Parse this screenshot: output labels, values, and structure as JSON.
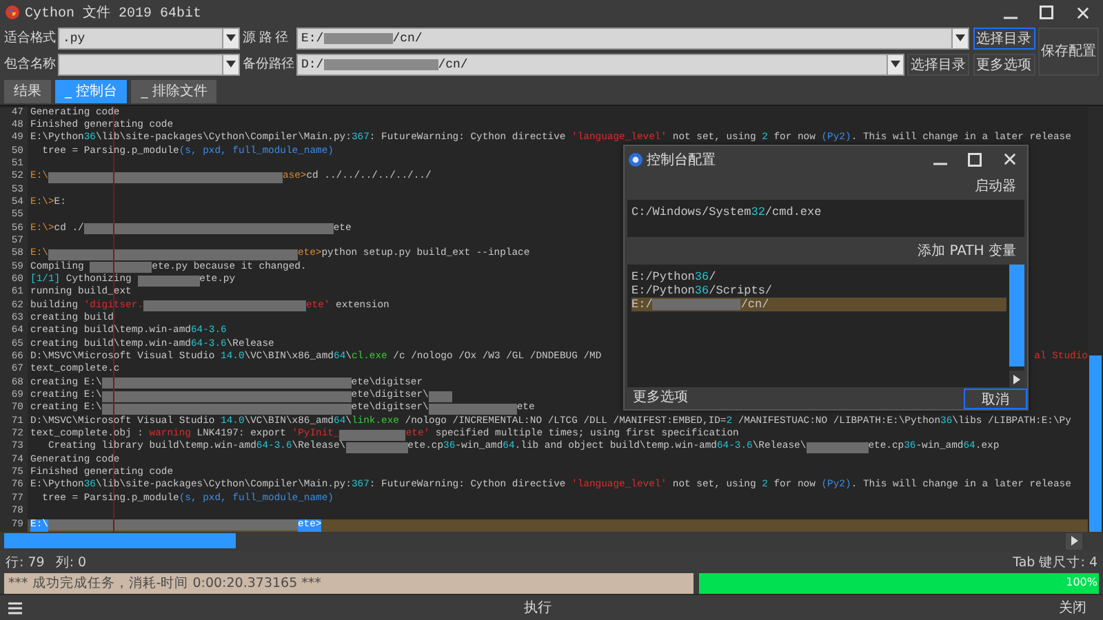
{
  "window": {
    "title": "Cython 文件 2019 64bit"
  },
  "format": {
    "label": "适合格式",
    "value": ".py"
  },
  "source": {
    "label": "源 路 径",
    "value": [
      {
        "kind": "plain",
        "text": "E:/"
      },
      {
        "kind": "redacted"
      },
      {
        "kind": "plain",
        "text": "/cn/"
      }
    ],
    "button": {
      "label": "选择目录",
      "focused": true
    }
  },
  "name_filter": {
    "label": "包含名称"
  },
  "backup": {
    "label": "备份路径",
    "value": [
      {
        "kind": "plain",
        "text": "D:/"
      },
      {
        "kind": "redacted"
      },
      {
        "kind": "plain",
        "text": "/cn/"
      }
    ],
    "button": {
      "label": "选择目录",
      "focused": false
    }
  },
  "more_button": {
    "label": "更多选项",
    "focused": false
  },
  "save_button": {
    "label": "保存配置",
    "focused": false
  },
  "tabs": [
    {
      "label": "结果",
      "selected": false
    },
    {
      "label": "_ 控制台",
      "selected": true
    },
    {
      "label": "_ 排除文件",
      "selected": false
    }
  ],
  "console": {
    "lines": [
      {
        "number": "47",
        "current": false,
        "segs": [
          {
            "kind": "plain",
            "text": "Generating code"
          }
        ]
      },
      {
        "number": "48",
        "current": false,
        "segs": [
          {
            "kind": "plain",
            "text": "Finished generating code"
          }
        ]
      },
      {
        "number": "49",
        "current": false,
        "segs": [
          {
            "kind": "plain",
            "text": "E:\\Python"
          },
          {
            "kind": "num",
            "text": "36"
          },
          {
            "kind": "plain",
            "text": "\\lib\\site-packages\\Cython\\Compiler\\Main.py:"
          },
          {
            "kind": "num",
            "text": "367"
          },
          {
            "kind": "plain",
            "text": ": FutureWarning: Cython directive "
          },
          {
            "kind": "str",
            "text": "'language_level'"
          },
          {
            "kind": "plain",
            "text": " not set, using "
          },
          {
            "kind": "num",
            "text": "2"
          },
          {
            "kind": "plain",
            "text": " for now "
          },
          {
            "kind": "blue",
            "text": "(Py2)"
          },
          {
            "kind": "plain",
            "text": ". This will change in a later release"
          }
        ]
      },
      {
        "number": "50",
        "current": false,
        "segs": [
          {
            "kind": "plain",
            "text": "  tree = Parsing.p_module"
          },
          {
            "kind": "blue",
            "text": "(s, pxd, full_module_name)"
          }
        ]
      },
      {
        "number": "51",
        "current": false
      },
      {
        "number": "52",
        "current": false,
        "segs": [
          {
            "kind": "prompt",
            "text": "E:\\"
          },
          {
            "kind": "redacted"
          },
          {
            "kind": "prompt",
            "text": "ase>"
          },
          {
            "kind": "plain",
            "text": "cd ../../../../../../"
          }
        ]
      },
      {
        "number": "53",
        "current": false
      },
      {
        "number": "54",
        "current": false,
        "segs": [
          {
            "kind": "prompt",
            "text": "E:\\>"
          },
          {
            "kind": "plain",
            "text": "E:"
          }
        ]
      },
      {
        "number": "55",
        "current": false
      },
      {
        "number": "56",
        "current": false,
        "segs": [
          {
            "kind": "prompt",
            "text": "E:\\>"
          },
          {
            "kind": "plain",
            "text": "cd ./"
          },
          {
            "kind": "redacted"
          },
          {
            "kind": "plain",
            "text": "ete"
          }
        ]
      },
      {
        "number": "57",
        "current": false
      },
      {
        "number": "58",
        "current": false,
        "segs": [
          {
            "kind": "prompt",
            "text": "E:\\"
          },
          {
            "kind": "redacted"
          },
          {
            "kind": "prompt",
            "text": "ete>"
          },
          {
            "kind": "plain",
            "text": "python setup.py build_ext --inplace"
          }
        ]
      },
      {
        "number": "59",
        "current": false,
        "segs": [
          {
            "kind": "plain",
            "text": "Compiling "
          },
          {
            "kind": "redacted"
          },
          {
            "kind": "plain",
            "text": "ete.py because it changed."
          }
        ]
      },
      {
        "number": "60",
        "current": false,
        "segs": [
          {
            "kind": "num",
            "text": "[1/1]"
          },
          {
            "kind": "plain",
            "text": " Cythonizing "
          },
          {
            "kind": "redacted"
          },
          {
            "kind": "plain",
            "text": "ete.py"
          }
        ]
      },
      {
        "number": "61",
        "current": false,
        "segs": [
          {
            "kind": "plain",
            "text": "running build_ext"
          }
        ]
      },
      {
        "number": "62",
        "current": false,
        "segs": [
          {
            "kind": "plain",
            "text": "building "
          },
          {
            "kind": "str",
            "text": "'digitser."
          },
          {
            "kind": "redacted"
          },
          {
            "kind": "str",
            "text": "ete'"
          },
          {
            "kind": "plain",
            "text": " extension"
          }
        ]
      },
      {
        "number": "63",
        "current": false,
        "segs": [
          {
            "kind": "plain",
            "text": "creating build"
          }
        ]
      },
      {
        "number": "64",
        "current": false,
        "segs": [
          {
            "kind": "plain",
            "text": "creating build\\temp.win-amd"
          },
          {
            "kind": "num",
            "text": "64-3.6"
          }
        ]
      },
      {
        "number": "65",
        "current": false,
        "segs": [
          {
            "kind": "plain",
            "text": "creating build\\temp.win-amd"
          },
          {
            "kind": "num",
            "text": "64-3.6"
          },
          {
            "kind": "plain",
            "text": "\\Release"
          }
        ]
      },
      {
        "number": "66",
        "current": false,
        "segs": [
          {
            "kind": "plain",
            "text": "D:\\MSVC\\Microsoft Visual Studio "
          },
          {
            "kind": "num",
            "text": "14.0"
          },
          {
            "kind": "plain",
            "text": "\\VC\\BIN\\x86_amd"
          },
          {
            "kind": "num",
            "text": "64"
          },
          {
            "kind": "plain",
            "text": "\\"
          },
          {
            "kind": "call",
            "text": "cl.exe"
          },
          {
            "kind": "plain",
            "text": " /c /nologo /Ox /W3 /GL /DNDEBUG /MD"
          },
          {
            "kind": "gap"
          },
          {
            "kind": "str",
            "text": "al Studio"
          }
        ]
      },
      {
        "number": "67",
        "current": false,
        "segs": [
          {
            "kind": "plain",
            "text": "text_complete.c"
          }
        ]
      },
      {
        "number": "68",
        "current": false,
        "segs": [
          {
            "kind": "plain",
            "text": "creating E:\\"
          },
          {
            "kind": "redacted"
          },
          {
            "kind": "plain",
            "text": "ete\\digitser"
          }
        ]
      },
      {
        "number": "69",
        "current": false,
        "segs": [
          {
            "kind": "plain",
            "text": "creating E:\\"
          },
          {
            "kind": "redacted"
          },
          {
            "kind": "plain",
            "text": "ete\\digitser\\"
          },
          {
            "kind": "redacted"
          }
        ]
      },
      {
        "number": "70",
        "current": false,
        "segs": [
          {
            "kind": "plain",
            "text": "creating E:\\"
          },
          {
            "kind": "redacted"
          },
          {
            "kind": "plain",
            "text": "ete\\digitser\\"
          },
          {
            "kind": "redacted"
          },
          {
            "kind": "plain",
            "text": "ete"
          }
        ]
      },
      {
        "number": "71",
        "current": false,
        "segs": [
          {
            "kind": "plain",
            "text": "D:\\MSVC\\Microsoft Visual Studio "
          },
          {
            "kind": "num",
            "text": "14.0"
          },
          {
            "kind": "plain",
            "text": "\\VC\\BIN\\x86_amd"
          },
          {
            "kind": "num",
            "text": "64"
          },
          {
            "kind": "plain",
            "text": "\\"
          },
          {
            "kind": "call",
            "text": "link.exe"
          },
          {
            "kind": "plain",
            "text": " /nologo /INCREMENTAL:NO /LTCG /DLL /MANIFEST:EMBED,ID="
          },
          {
            "kind": "num",
            "text": "2"
          },
          {
            "kind": "plain",
            "text": " /MANIFESTUAC:NO /LIBPATH:E:\\Python"
          },
          {
            "kind": "num",
            "text": "36"
          },
          {
            "kind": "plain",
            "text": "\\libs /LIBPATH:E:\\Py"
          }
        ]
      },
      {
        "number": "72",
        "current": false,
        "segs": [
          {
            "kind": "plain",
            "text": "text_complete.obj : "
          },
          {
            "kind": "str",
            "text": "warning"
          },
          {
            "kind": "plain",
            "text": " LNK4197: export "
          },
          {
            "kind": "str",
            "text": "'PyInit_"
          },
          {
            "kind": "redacted"
          },
          {
            "kind": "str",
            "text": "ete'"
          },
          {
            "kind": "plain",
            "text": " specified multiple times; using first specification"
          }
        ]
      },
      {
        "number": "73",
        "current": false,
        "segs": [
          {
            "kind": "plain",
            "text": "   Creating library build\\temp.win-amd"
          },
          {
            "kind": "num",
            "text": "64-3.6"
          },
          {
            "kind": "plain",
            "text": "\\Release\\"
          },
          {
            "kind": "redacted"
          },
          {
            "kind": "plain",
            "text": "ete.cp"
          },
          {
            "kind": "num",
            "text": "36"
          },
          {
            "kind": "plain",
            "text": "-win_amd"
          },
          {
            "kind": "num",
            "text": "64"
          },
          {
            "kind": "plain",
            "text": ".lib and object build\\temp.win-amd"
          },
          {
            "kind": "num",
            "text": "64-3.6"
          },
          {
            "kind": "plain",
            "text": "\\Release\\"
          },
          {
            "kind": "redacted"
          },
          {
            "kind": "plain",
            "text": "ete.cp"
          },
          {
            "kind": "num",
            "text": "36"
          },
          {
            "kind": "plain",
            "text": "-win_amd"
          },
          {
            "kind": "num",
            "text": "64"
          },
          {
            "kind": "plain",
            "text": ".exp"
          }
        ]
      },
      {
        "number": "74",
        "current": false,
        "segs": [
          {
            "kind": "plain",
            "text": "Generating code"
          }
        ]
      },
      {
        "number": "75",
        "current": false,
        "segs": [
          {
            "kind": "plain",
            "text": "Finished generating code"
          }
        ]
      },
      {
        "number": "76",
        "current": false,
        "segs": [
          {
            "kind": "plain",
            "text": "E:\\Python"
          },
          {
            "kind": "num",
            "text": "36"
          },
          {
            "kind": "plain",
            "text": "\\lib\\site-packages\\Cython\\Compiler\\Main.py:"
          },
          {
            "kind": "num",
            "text": "367"
          },
          {
            "kind": "plain",
            "text": ": FutureWarning: Cython directive "
          },
          {
            "kind": "str",
            "text": "'language_level'"
          },
          {
            "kind": "plain",
            "text": " not set, using "
          },
          {
            "kind": "num",
            "text": "2"
          },
          {
            "kind": "plain",
            "text": " for now "
          },
          {
            "kind": "blue",
            "text": "(Py2)"
          },
          {
            "kind": "plain",
            "text": ". This will change in a later release"
          }
        ]
      },
      {
        "number": "77",
        "current": false,
        "segs": [
          {
            "kind": "plain",
            "text": "  tree = Parsing.p_module"
          },
          {
            "kind": "blue",
            "text": "(s, pxd, full_module_name)"
          }
        ]
      },
      {
        "number": "78",
        "current": false
      },
      {
        "number": "79",
        "current": true,
        "segs": [
          {
            "kind": "sel",
            "text": "E:\\"
          },
          {
            "kind": "redacted"
          },
          {
            "kind": "sel",
            "text": "ete>"
          }
        ]
      }
    ]
  },
  "position": {
    "line": "行: 79",
    "column": "列: 0"
  },
  "tab_size": "Tab 键尺寸: 4",
  "status_message": "*** 成功完成任务，消耗-时间 0:00:20.373165 ***",
  "progress": {
    "level": 1,
    "label": "100%"
  },
  "run_button": "执行",
  "close_button": "关闭",
  "dialog": {
    "title": "控制台配置",
    "launcher_label": "启动器",
    "launcher": [
      {
        "kind": "plain",
        "text": "C:/Windows/System"
      },
      {
        "kind": "num",
        "text": "32"
      },
      {
        "kind": "plain",
        "text": "/cmd.exe"
      }
    ],
    "path_label": "添加 PATH 变量",
    "paths": [
      {
        "selected": false,
        "segs": [
          {
            "kind": "plain",
            "text": "E:/Python"
          },
          {
            "kind": "num",
            "text": "36"
          },
          {
            "kind": "plain",
            "text": "/"
          }
        ]
      },
      {
        "selected": false,
        "segs": [
          {
            "kind": "plain",
            "text": "E:/Python"
          },
          {
            "kind": "num",
            "text": "36"
          },
          {
            "kind": "plain",
            "text": "/Scripts/"
          }
        ]
      },
      {
        "selected": true,
        "segs": [
          {
            "kind": "plain",
            "text": "E:/"
          },
          {
            "kind": "redacted"
          },
          {
            "kind": "plain",
            "text": "/cn/"
          }
        ]
      }
    ],
    "more": "更多选项",
    "cancel": {
      "label": "取消",
      "focused": true
    }
  }
}
